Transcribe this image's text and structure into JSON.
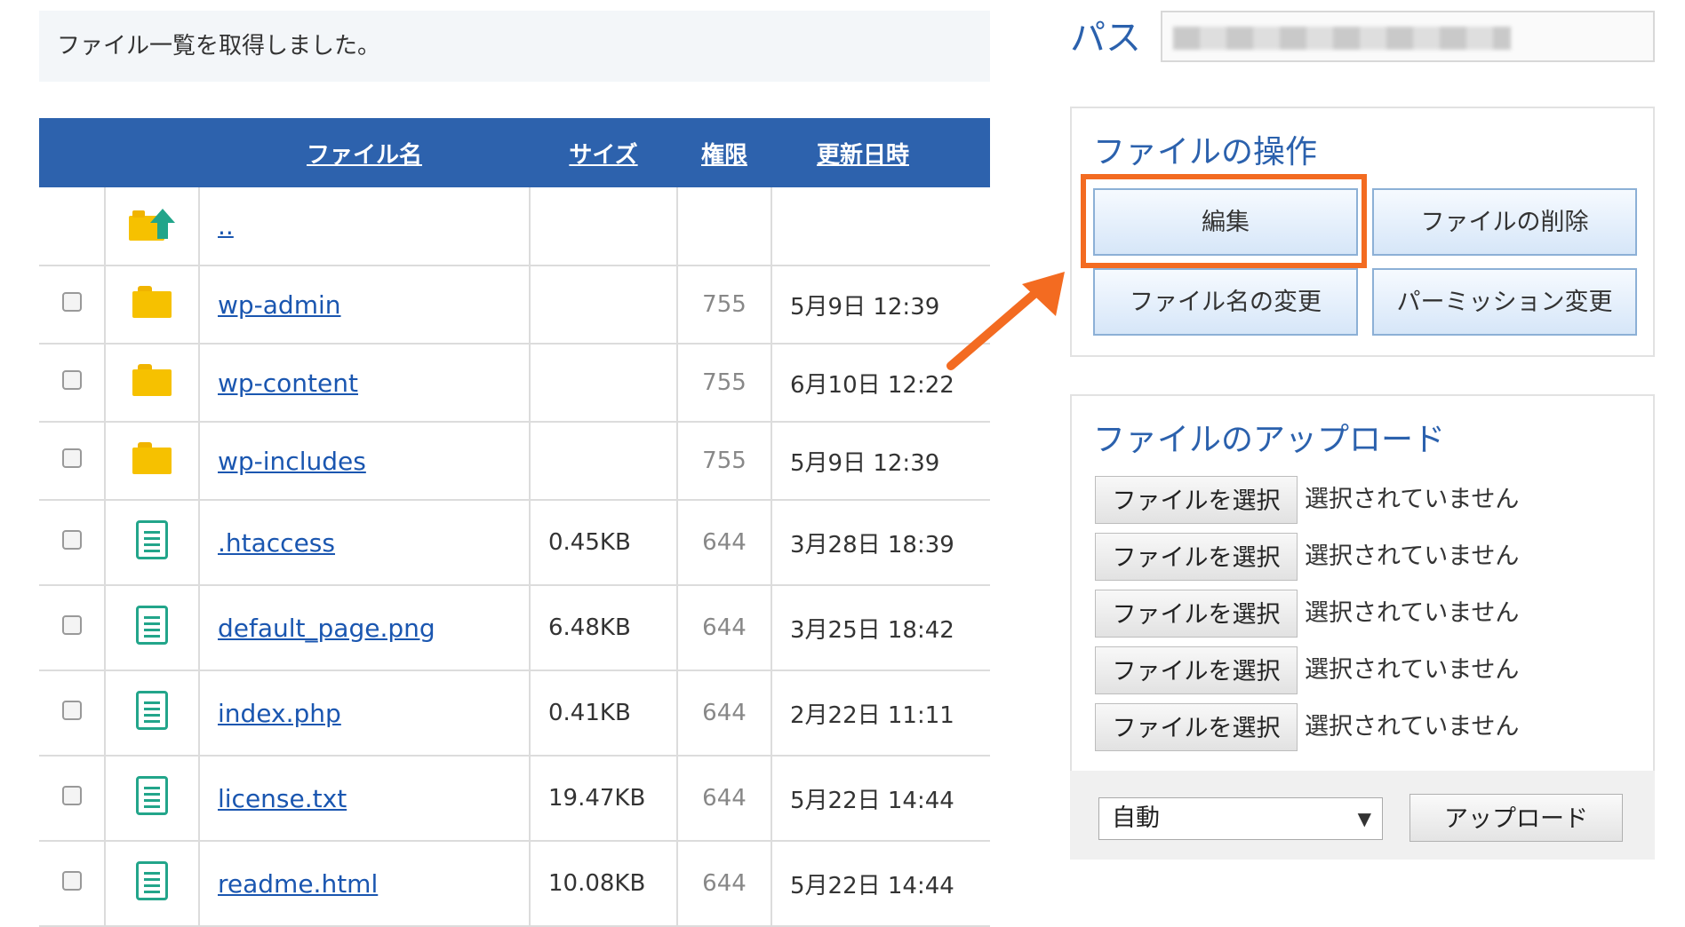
{
  "notice": "ファイル一覧を取得しました。",
  "table": {
    "headers": {
      "name": "ファイル名",
      "size": "サイズ",
      "perm": "権限",
      "date": "更新日時"
    },
    "parent": {
      "name": ".."
    },
    "rows": [
      {
        "type": "folder",
        "name": "wp-admin",
        "size": "",
        "perm": "755",
        "date": "5月9日 12:39"
      },
      {
        "type": "folder",
        "name": "wp-content",
        "size": "",
        "perm": "755",
        "date": "6月10日 12:22"
      },
      {
        "type": "folder",
        "name": "wp-includes",
        "size": "",
        "perm": "755",
        "date": "5月9日 12:39"
      },
      {
        "type": "file",
        "name": ".htaccess",
        "size": "0.45KB",
        "perm": "644",
        "date": "3月28日 18:39"
      },
      {
        "type": "file",
        "name": "default_page.png",
        "size": "6.48KB",
        "perm": "644",
        "date": "3月25日 18:42"
      },
      {
        "type": "file",
        "name": "index.php",
        "size": "0.41KB",
        "perm": "644",
        "date": "2月22日 11:11"
      },
      {
        "type": "file",
        "name": "license.txt",
        "size": "19.47KB",
        "perm": "644",
        "date": "5月22日 14:44"
      },
      {
        "type": "file",
        "name": "readme.html",
        "size": "10.08KB",
        "perm": "644",
        "date": "5月22日 14:44"
      }
    ]
  },
  "path": {
    "label": "パス"
  },
  "ops": {
    "title": "ファイルの操作",
    "edit": "編集",
    "delete": "ファイルの削除",
    "rename": "ファイル名の変更",
    "permission": "パーミッション変更"
  },
  "upload": {
    "title": "ファイルのアップロード",
    "choose_label": "ファイルを選択",
    "no_file": "選択されていません",
    "mode": "自動",
    "upload_label": "アップロード"
  },
  "colors": {
    "accent": "#2d62ad",
    "highlight": "#f36b21",
    "folder": "#f6c100",
    "file": "#22a58a"
  }
}
